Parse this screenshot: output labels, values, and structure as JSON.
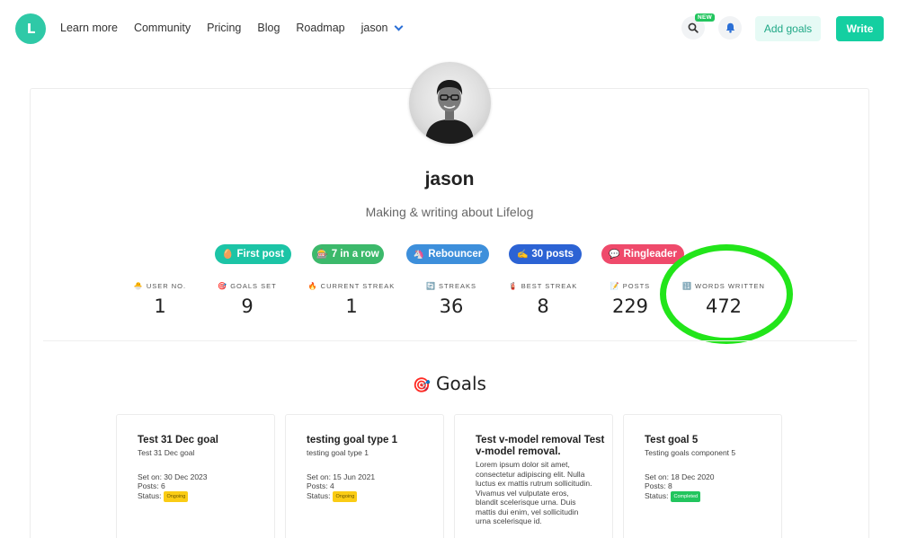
{
  "nav": {
    "logo_text": "L",
    "links": [
      "Learn more",
      "Community",
      "Pricing",
      "Blog",
      "Roadmap"
    ],
    "user": "jason",
    "new_badge": "NEW",
    "add_goals": "Add goals",
    "write": "Write"
  },
  "profile": {
    "username": "jason",
    "bio": "Making & writing about Lifelog"
  },
  "badges": [
    {
      "emoji": "🥚",
      "label": "First post",
      "color": "#1cc4a6"
    },
    {
      "emoji": "🎰",
      "label": "7 in a row",
      "color": "#3cb96b"
    },
    {
      "emoji": "🦄",
      "label": "Rebouncer",
      "color": "#3d8fdb"
    },
    {
      "emoji": "✍️",
      "label": "30 posts",
      "color": "#2c63d4"
    },
    {
      "emoji": "💬",
      "label": "Ringleader",
      "color": "#ef4a6b"
    }
  ],
  "stats": [
    {
      "emoji": "🐣",
      "label": "USER NO.",
      "value": "1"
    },
    {
      "emoji": "🎯",
      "label": "GOALS SET",
      "value": "9"
    },
    {
      "emoji": "🔥",
      "label": "CURRENT STREAK",
      "value": "1"
    },
    {
      "emoji": "🔄",
      "label": "STREAKS",
      "value": "36"
    },
    {
      "emoji": "🧯",
      "label": "BEST STREAK",
      "value": "8"
    },
    {
      "emoji": "📝",
      "label": "POSTS",
      "value": "229"
    },
    {
      "emoji": "🔢",
      "label": "WORDS WRITTEN",
      "value": "472"
    }
  ],
  "goals_section": {
    "emoji": "🎯",
    "title": "Goals"
  },
  "goals": [
    {
      "title": "Test 31 Dec goal",
      "subtitle": "Test 31 Dec goal",
      "set_on": "Set on: 30 Dec 2023",
      "posts": "Posts: 6",
      "status_label": "Status:",
      "status": "Ongoing"
    },
    {
      "title": "testing goal type 1",
      "subtitle": "testing goal type 1",
      "set_on": "Set on: 15 Jun 2021",
      "posts": "Posts: 4",
      "status_label": "Status:",
      "status": "Ongoing"
    },
    {
      "title": "Test v-model removal Test v-model removal.",
      "subtitle": "Lorem ipsum dolor sit amet, consectetur adipiscing elit. Nulla luctus ex mattis rutrum sollicitudin. Vivamus vel vulputate eros, blandit scelerisque urna. Duis mattis dui enim, vel sollicitudin urna scelerisque id.",
      "set_on": "",
      "posts": "",
      "status_label": "",
      "status": ""
    },
    {
      "title": "Test goal 5",
      "subtitle": "Testing goals component 5",
      "set_on": "Set on: 18 Dec 2020",
      "posts": "Posts: 8",
      "status_label": "Status:",
      "status": "Completed"
    }
  ],
  "highlight_color": "#22e51a"
}
